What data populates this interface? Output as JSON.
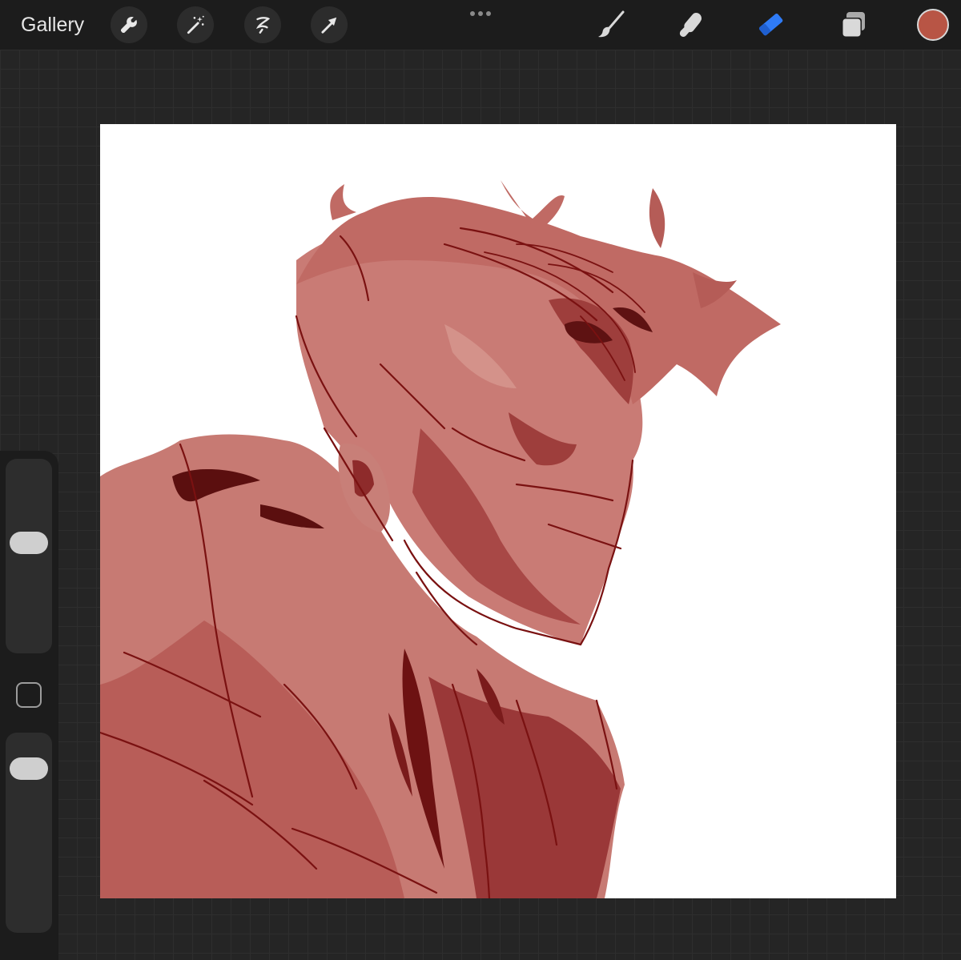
{
  "toolbar": {
    "gallery_label": "Gallery",
    "left_tools": [
      "wrench-icon",
      "magic-wand-icon",
      "selection-icon",
      "transform-arrow-icon"
    ],
    "right_tools": [
      "brush-icon",
      "smudge-icon",
      "eraser-icon",
      "layers-icon"
    ],
    "active_tool": "eraser",
    "current_color": "#b85545",
    "active_tool_color": "#2f7bf6"
  },
  "sidebar": {
    "brush_size_level": 0.58,
    "opacity_level": 0.88
  }
}
